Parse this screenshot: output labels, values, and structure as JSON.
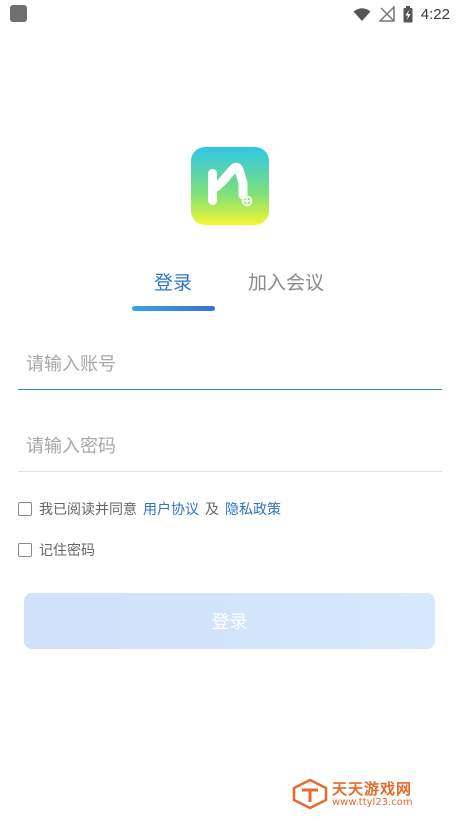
{
  "status_bar": {
    "time": "4:22"
  },
  "tabs": [
    {
      "label": "登录",
      "active": true
    },
    {
      "label": "加入会议",
      "active": false
    }
  ],
  "form": {
    "account_placeholder": "请输入账号",
    "password_placeholder": "请输入密码"
  },
  "agreement": {
    "prefix": "我已阅读并同意",
    "user_agreement": "用户协议",
    "and": "及",
    "privacy_policy": "隐私政策"
  },
  "remember": {
    "label": "记住密码"
  },
  "login_button": {
    "label": "登录"
  },
  "watermark": {
    "title": "天天游戏网",
    "url": "www.ttyl23.com"
  },
  "colors": {
    "accent": "#2f73c7",
    "button": "#d2e4fb",
    "watermark": "#e56a2c"
  }
}
